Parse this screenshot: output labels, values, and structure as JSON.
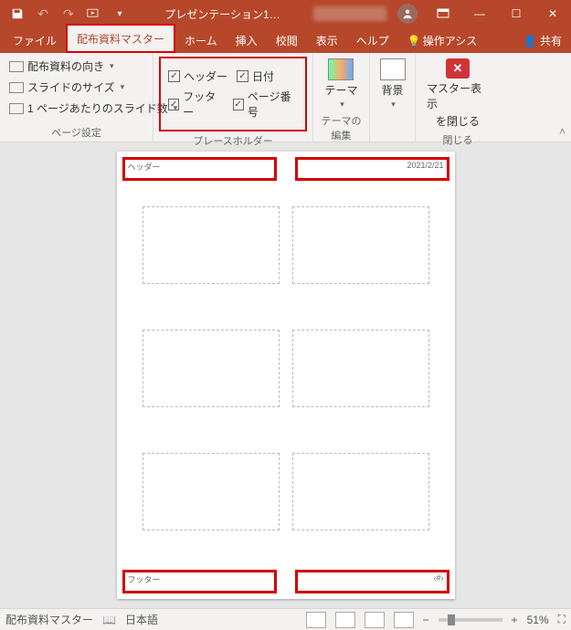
{
  "titlebar": {
    "title": "プレゼンテーション1…"
  },
  "tabs": {
    "file": "ファイル",
    "handout_master": "配布資料マスター",
    "home": "ホーム",
    "insert": "挿入",
    "review": "校閲",
    "view": "表示",
    "help": "ヘルプ",
    "tell_me": "操作アシス",
    "share": "共有"
  },
  "ribbon": {
    "page_setup": {
      "orientation": "配布資料の向き",
      "slide_size": "スライドのサイズ",
      "slides_per_page": "1 ページあたりのスライド数",
      "group_label": "ページ設定"
    },
    "placeholders": {
      "header": "ヘッダー",
      "date": "日付",
      "footer": "フッター",
      "page_number": "ページ番号",
      "group_label": "プレースホルダー"
    },
    "edit_theme": {
      "themes": "テーマ",
      "group_label": "テーマの編集"
    },
    "background": {
      "background": "背景"
    },
    "close": {
      "line1": "マスター表示",
      "line2": "を閉じる",
      "group_label": "閉じる"
    }
  },
  "page": {
    "header_text": "ヘッダー",
    "date_text": "2021/2/21",
    "footer_text": "フッター",
    "page_number_text": "‹#›"
  },
  "statusbar": {
    "view_name": "配布資料マスター",
    "language": "日本語",
    "zoom": "51%"
  }
}
